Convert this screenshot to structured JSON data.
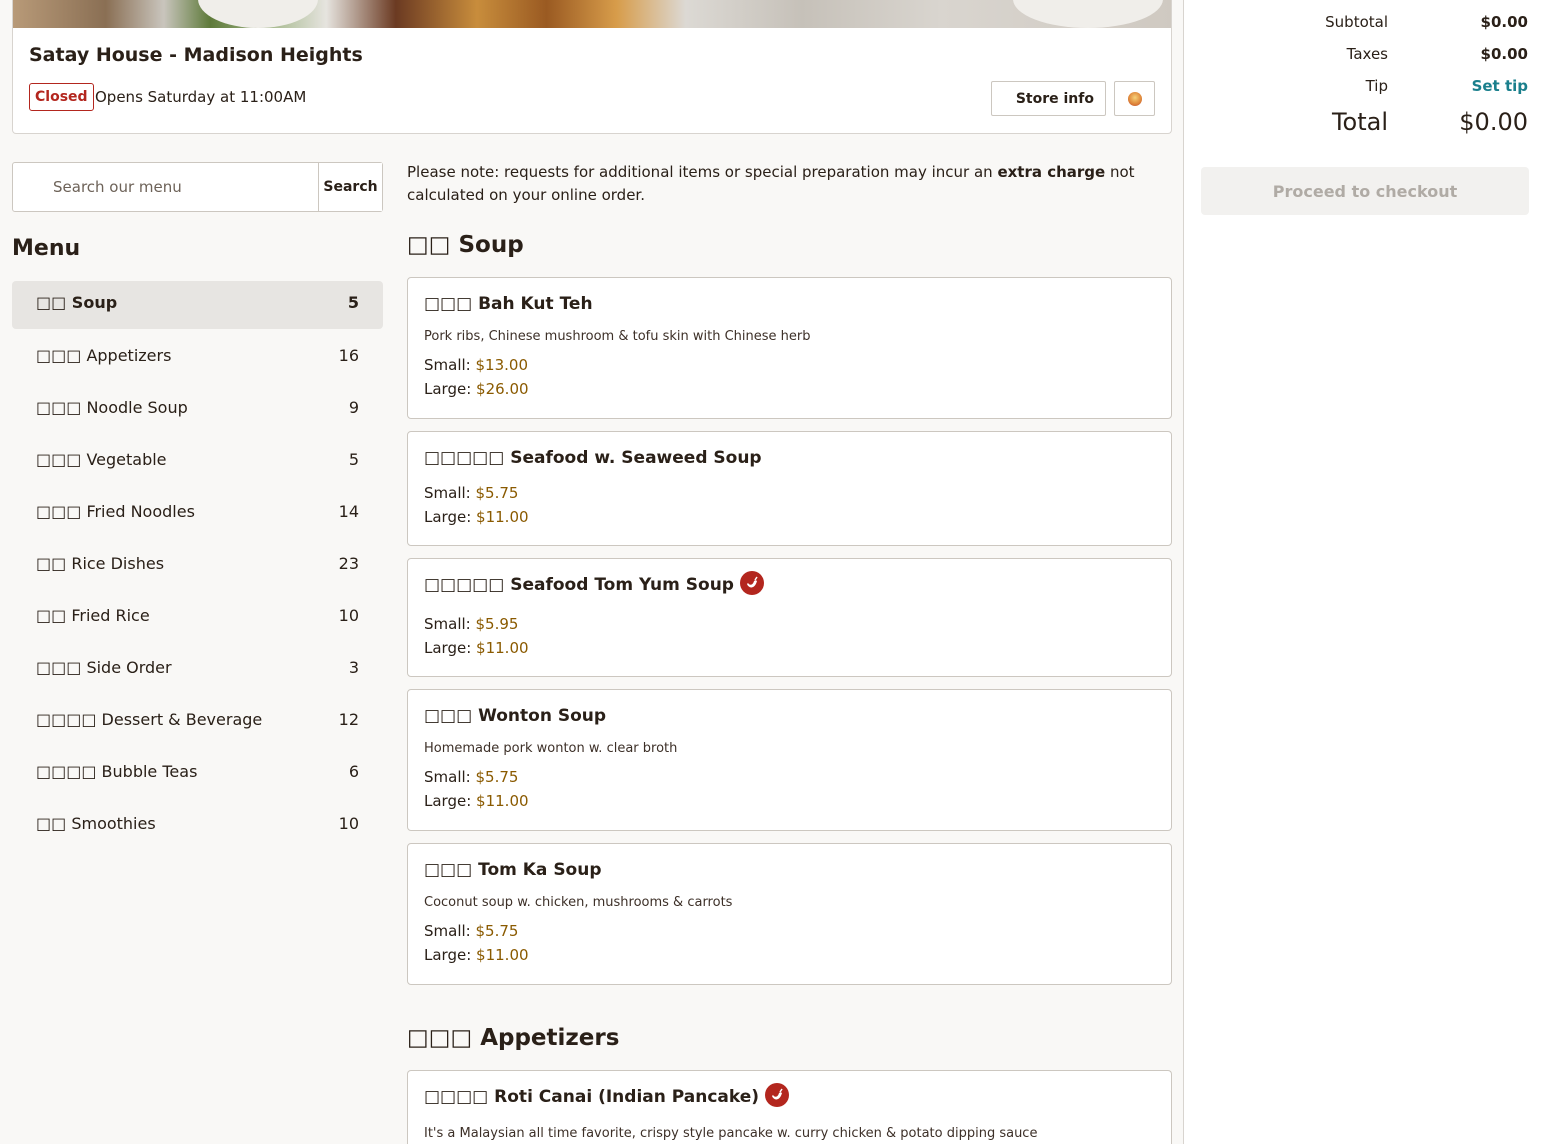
{
  "store": {
    "name": "Satay House - Madison Heights",
    "status_badge": "Closed",
    "opens_text": "Opens Saturday at 11:00AM",
    "store_info_label": "Store info"
  },
  "search": {
    "placeholder": "Search our menu",
    "button_label": "Search"
  },
  "menu": {
    "title": "Menu",
    "categories": [
      {
        "label": "□□ Soup",
        "count": "5"
      },
      {
        "label": "□□□ Appetizers",
        "count": "16"
      },
      {
        "label": "□□□ Noodle Soup",
        "count": "9"
      },
      {
        "label": "□□□ Vegetable",
        "count": "5"
      },
      {
        "label": "□□□ Fried Noodles",
        "count": "14"
      },
      {
        "label": "□□ Rice Dishes",
        "count": "23"
      },
      {
        "label": "□□ Fried Rice",
        "count": "10"
      },
      {
        "label": "□□□ Side Order",
        "count": "3"
      },
      {
        "label": "□□□□ Dessert & Beverage",
        "count": "12"
      },
      {
        "label": "□□□□ Bubble Teas",
        "count": "6"
      },
      {
        "label": "□□ Smoothies",
        "count": "10"
      }
    ]
  },
  "notice": {
    "before": "Please note: requests for additional items or special preparation may incur an ",
    "bold": "extra charge",
    "after": " not calculated on your online order."
  },
  "sections": [
    {
      "title": "□□ Soup",
      "items": [
        {
          "name": "□□□ Bah Kut Teh",
          "desc": "Pork ribs, Chinese mushroom & tofu skin with Chinese herb",
          "prices": [
            {
              "label": "Small:",
              "value": "$13.00"
            },
            {
              "label": "Large:",
              "value": "$26.00"
            }
          ]
        },
        {
          "name": "□□□□□ Seafood w. Seaweed Soup",
          "prices": [
            {
              "label": "Small:",
              "value": "$5.75"
            },
            {
              "label": "Large:",
              "value": "$11.00"
            }
          ]
        },
        {
          "name": "□□□□□ Seafood Tom Yum Soup",
          "spicy": "chili-pepper-icon",
          "prices": [
            {
              "label": "Small:",
              "value": "$5.95"
            },
            {
              "label": "Large:",
              "value": "$11.00"
            }
          ]
        },
        {
          "name": "□□□ Wonton Soup",
          "desc": "Homemade pork wonton w. clear broth",
          "prices": [
            {
              "label": "Small:",
              "value": "$5.75"
            },
            {
              "label": "Large:",
              "value": "$11.00"
            }
          ]
        },
        {
          "name": "□□□ Tom Ka Soup",
          "desc": "Coconut soup w. chicken, mushrooms & carrots",
          "prices": [
            {
              "label": "Small:",
              "value": "$5.75"
            },
            {
              "label": "Large:",
              "value": "$11.00"
            }
          ]
        }
      ]
    },
    {
      "title": "□□□ Appetizers",
      "items": [
        {
          "name": "□□□□ Roti Canai (Indian Pancake)",
          "spicy": "chili-pepper-icon",
          "desc": "It's a Malaysian all time favorite, crispy style pancake w. curry chicken & potato dipping sauce"
        }
      ]
    }
  ],
  "cart": {
    "subtotal_label": "Subtotal",
    "subtotal_value": "$0.00",
    "taxes_label": "Taxes",
    "taxes_value": "$0.00",
    "tip_label": "Tip",
    "tip_action": "Set tip",
    "total_label": "Total",
    "total_value": "$0.00",
    "checkout_label": "Proceed to checkout"
  },
  "colors": {
    "price": "#8a5a00",
    "accent_teal": "#1a7f8c",
    "closed_red": "#b3261e"
  }
}
